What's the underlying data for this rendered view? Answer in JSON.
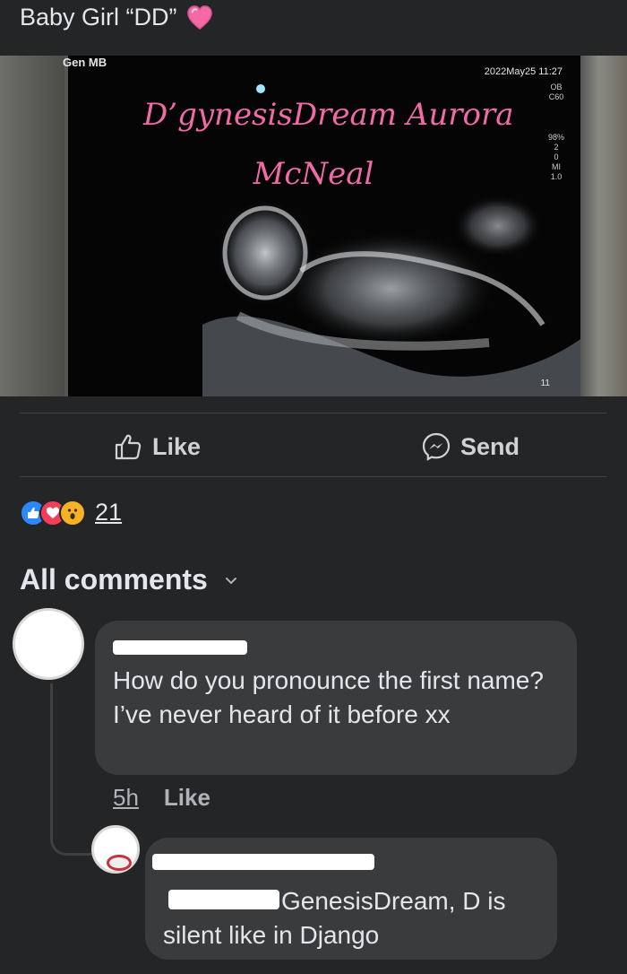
{
  "post": {
    "caption": "Baby Girl “DD”",
    "caption_emoji": "pink-heart-icon",
    "photo": {
      "monitor_label": "Gen MB",
      "date_stamp": "2022May25  11:27",
      "side_readout": [
        "OB",
        "C60",
        "98%",
        "2",
        "0",
        "MI",
        "1.0"
      ],
      "frame_number": "11",
      "name_line1": "D’gynesisDream Aurora",
      "name_line2": "McNeal"
    }
  },
  "actions": {
    "like_label": "Like",
    "send_label": "Send"
  },
  "reactions": {
    "icons": [
      "like-reaction-icon",
      "love-reaction-icon",
      "wow-reaction-icon"
    ],
    "count": "21"
  },
  "comments": {
    "header": "All comments",
    "items": [
      {
        "text": "How do you pronounce the first name? I’ve never heard of it before xx",
        "time": "5h",
        "like_label": "Like"
      },
      {
        "text": "GenesisDream, D is silent like in Django"
      }
    ]
  },
  "colors": {
    "background": "#242526",
    "bubble": "#3a3b3c",
    "text": "#e4e6eb",
    "muted": "#b0b3b8",
    "scan_name": "#f06aa8"
  }
}
